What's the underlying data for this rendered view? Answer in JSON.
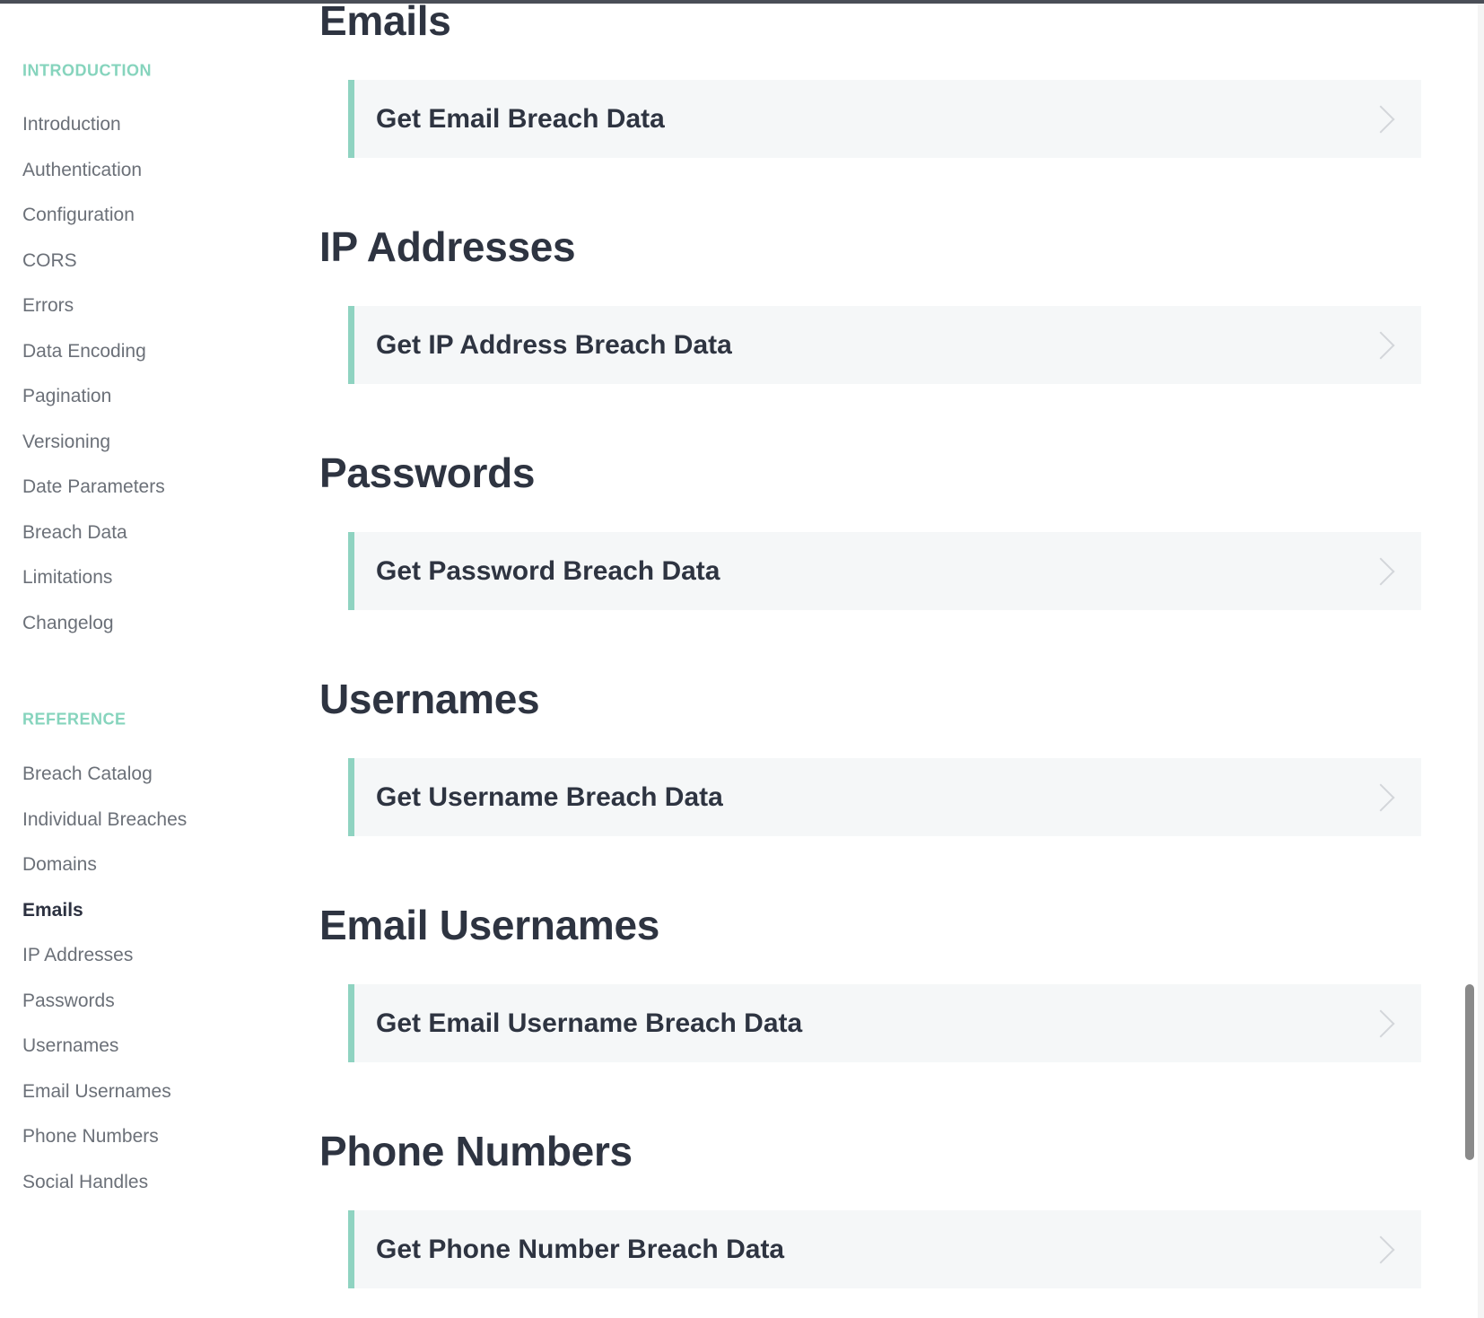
{
  "sidebar": {
    "sections": [
      {
        "title": "INTRODUCTION",
        "items": [
          {
            "label": "Introduction"
          },
          {
            "label": "Authentication"
          },
          {
            "label": "Configuration"
          },
          {
            "label": "CORS"
          },
          {
            "label": "Errors"
          },
          {
            "label": "Data Encoding"
          },
          {
            "label": "Pagination"
          },
          {
            "label": "Versioning"
          },
          {
            "label": "Date Parameters"
          },
          {
            "label": "Breach Data"
          },
          {
            "label": "Limitations"
          },
          {
            "label": "Changelog"
          }
        ]
      },
      {
        "title": "REFERENCE",
        "items": [
          {
            "label": "Breach Catalog"
          },
          {
            "label": "Individual Breaches"
          },
          {
            "label": "Domains"
          },
          {
            "label": "Emails",
            "active": true
          },
          {
            "label": "IP Addresses"
          },
          {
            "label": "Passwords"
          },
          {
            "label": "Usernames"
          },
          {
            "label": "Email Usernames"
          },
          {
            "label": "Phone Numbers"
          },
          {
            "label": "Social Handles"
          }
        ]
      }
    ]
  },
  "main": {
    "sections": [
      {
        "heading": "Emails",
        "card": "Get Email Breach Data"
      },
      {
        "heading": "IP Addresses",
        "card": "Get IP Address Breach Data"
      },
      {
        "heading": "Passwords",
        "card": "Get Password Breach Data"
      },
      {
        "heading": "Usernames",
        "card": "Get Username Breach Data"
      },
      {
        "heading": "Email Usernames",
        "card": "Get Email Username Breach Data"
      },
      {
        "heading": "Phone Numbers",
        "card": "Get Phone Number Breach Data"
      }
    ]
  },
  "icons": {
    "card_arrow": "chevron-right-icon"
  },
  "colors": {
    "accent": "#8fd3c1",
    "section_header": "#86d4bd",
    "heading": "#2e3441",
    "card_bg": "#f5f7f8"
  }
}
